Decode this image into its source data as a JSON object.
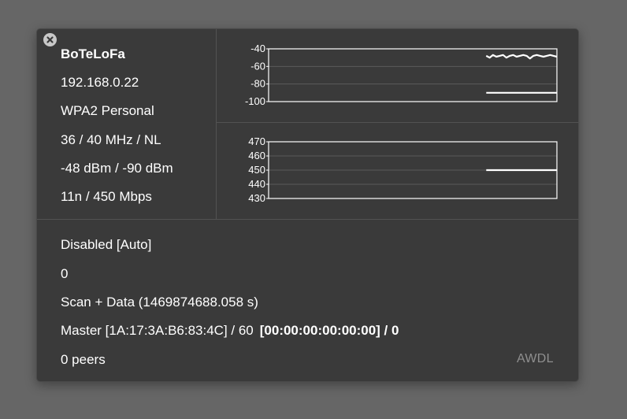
{
  "info": {
    "ssid": "BoTeLoFa",
    "ip": "192.168.0.22",
    "security": "WPA2 Personal",
    "channel": "36 / 40 MHz / NL",
    "signal": "-48 dBm / -90 dBm",
    "rate": "11n / 450 Mbps"
  },
  "rssi_graph": {
    "ticks": [
      "-40",
      "-60",
      "-80",
      "-100"
    ],
    "ylim": [
      -100,
      -40
    ],
    "series": [
      {
        "values": [
          -48,
          -50,
          -47,
          -49,
          -48,
          -47,
          -50,
          -48,
          -47,
          -49,
          -48,
          -47,
          -48,
          -51,
          -48,
          -47,
          -48,
          -49,
          -48,
          -47,
          -48,
          -49
        ]
      },
      {
        "values": [
          -90,
          -90,
          -90,
          -90,
          -90,
          -90,
          -90,
          -90,
          -90,
          -90,
          -90,
          -90,
          -90,
          -90,
          -90,
          -90,
          -90,
          -90,
          -90,
          -90,
          -90,
          -90
        ]
      }
    ]
  },
  "rate_graph": {
    "ticks": [
      "470",
      "460",
      "450",
      "440",
      "430"
    ],
    "ylim": [
      430,
      470
    ],
    "series": [
      {
        "values": [
          450,
          450,
          450,
          450,
          450,
          450,
          450,
          450,
          450,
          450,
          450,
          450,
          450,
          450,
          450,
          450,
          450,
          450,
          450,
          450,
          450,
          450
        ]
      }
    ]
  },
  "awdl": {
    "status": "Disabled [Auto]",
    "count": "0",
    "mode": "Scan + Data (1469874688.058 s)",
    "master": "Master [1A:17:3A:B6:83:4C] / 60",
    "master_bold": "[00:00:00:00:00:00] / 0",
    "peers": "0 peers",
    "label": "AWDL"
  },
  "colors": {
    "background": "#666666",
    "panel": "#3a3a3a",
    "divider": "#525252",
    "text": "#ffffff",
    "muted": "#8f8f8f"
  }
}
